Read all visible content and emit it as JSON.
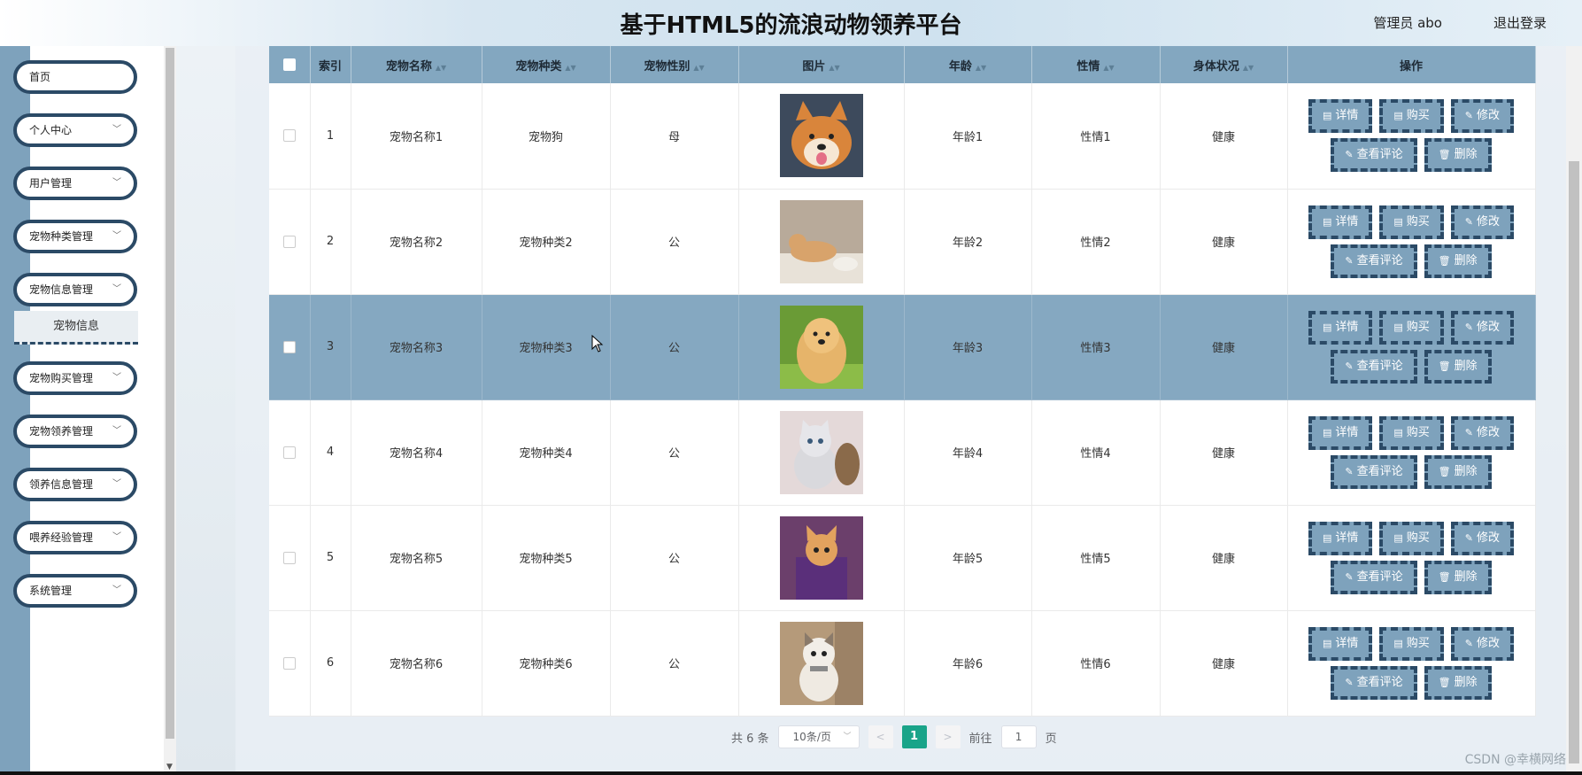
{
  "header": {
    "title": "基于HTML5的流浪动物领养平台",
    "user": "管理员 abo",
    "logout": "退出登录"
  },
  "sidebar": {
    "items": [
      {
        "label": "首页",
        "has_chevron": false
      },
      {
        "label": "个人中心",
        "has_chevron": true
      },
      {
        "label": "用户管理",
        "has_chevron": true
      },
      {
        "label": "宠物种类管理",
        "has_chevron": true
      },
      {
        "label": "宠物信息管理",
        "has_chevron": true,
        "expanded": true
      },
      {
        "label": "宠物购买管理",
        "has_chevron": true
      },
      {
        "label": "宠物领养管理",
        "has_chevron": true
      },
      {
        "label": "领养信息管理",
        "has_chevron": true
      },
      {
        "label": "喂养经验管理",
        "has_chevron": true
      },
      {
        "label": "系统管理",
        "has_chevron": true
      }
    ],
    "submenu": {
      "label": "宠物信息",
      "active": true
    }
  },
  "table": {
    "columns": [
      "",
      "索引",
      "宠物名称",
      "宠物种类",
      "宠物性别",
      "图片",
      "年龄",
      "性情",
      "身体状况",
      "操作"
    ],
    "sortable": [
      false,
      false,
      true,
      true,
      true,
      true,
      true,
      true,
      true,
      false
    ],
    "rows": [
      {
        "index": "1",
        "name": "宠物名称1",
        "type": "宠物狗",
        "gender": "母",
        "image": "shiba-dog-photo",
        "age": "年龄1",
        "temper": "性情1",
        "health": "健康"
      },
      {
        "index": "2",
        "name": "宠物名称2",
        "type": "宠物种类2",
        "gender": "公",
        "image": "lying-cat-photo",
        "age": "年龄2",
        "temper": "性情2",
        "health": "健康"
      },
      {
        "index": "3",
        "name": "宠物名称3",
        "type": "宠物种类3",
        "gender": "公",
        "image": "chow-dog-photo",
        "age": "年龄3",
        "temper": "性情3",
        "health": "健康",
        "highlighted": true
      },
      {
        "index": "4",
        "name": "宠物名称4",
        "type": "宠物种类4",
        "gender": "公",
        "image": "white-kitten-photo",
        "age": "年龄4",
        "temper": "性情4",
        "health": "健康"
      },
      {
        "index": "5",
        "name": "宠物名称5",
        "type": "宠物种类5",
        "gender": "公",
        "image": "kitten-in-bag-photo",
        "age": "年龄5",
        "temper": "性情5",
        "health": "健康"
      },
      {
        "index": "6",
        "name": "宠物名称6",
        "type": "宠物种类6",
        "gender": "公",
        "image": "grumpy-cat-photo",
        "age": "年龄6",
        "temper": "性情6",
        "health": "健康"
      }
    ],
    "actions": {
      "row1": [
        {
          "label": "详情",
          "icon": "document-icon"
        },
        {
          "label": "购买",
          "icon": "document-icon"
        },
        {
          "label": "修改",
          "icon": "edit-icon"
        }
      ],
      "row2": [
        {
          "label": "查看评论",
          "icon": "edit-icon"
        },
        {
          "label": "删除",
          "icon": "trash-icon"
        }
      ]
    }
  },
  "pagination": {
    "total": "共 6 条",
    "page_size": "10条/页",
    "current_page": "1",
    "goto_label": "前往",
    "goto_value": "1",
    "page_unit": "页"
  },
  "watermark": "CSDN @幸横网络",
  "colors": {
    "accent": "#7ea2bc",
    "dark_border": "#2b4a66",
    "header_row": "#83a7c0",
    "active_page": "#19a489"
  }
}
